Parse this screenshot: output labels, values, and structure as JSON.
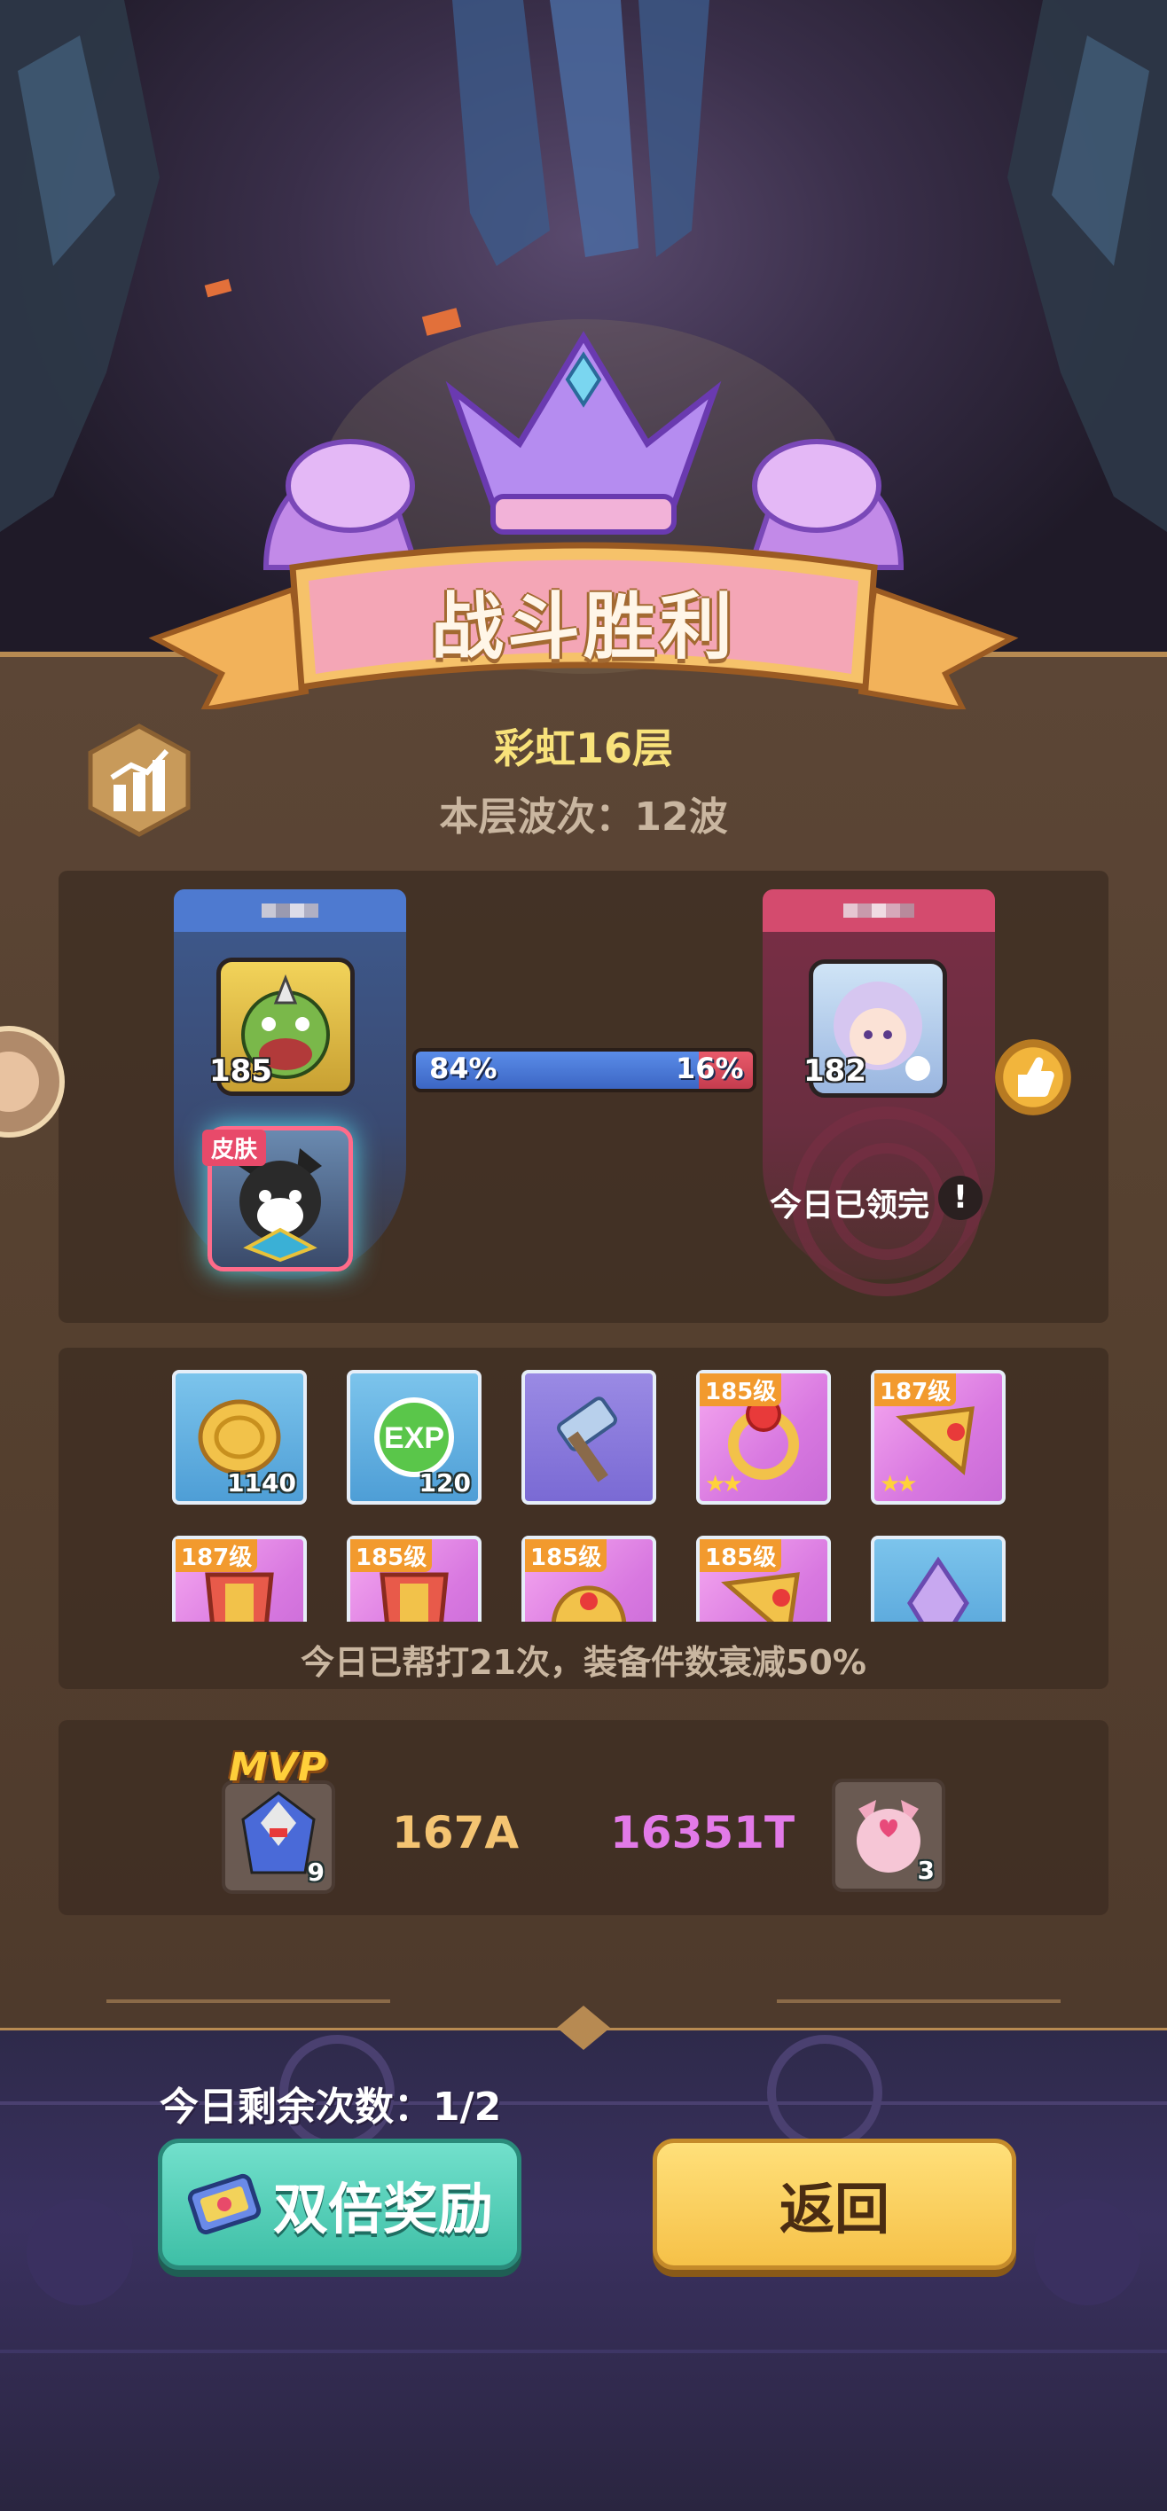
{
  "header": {
    "banner_title": "战斗胜利",
    "level_title": "彩虹16层",
    "wave_text": "本层波次：12波"
  },
  "battle": {
    "left_player": {
      "avatar_level": "185",
      "skin_badge": "皮肤"
    },
    "right_player": {
      "avatar_level": "182",
      "claimed_text": "今日已领完",
      "warning_glyph": "!"
    },
    "progress": {
      "left_percent_label": "84%",
      "right_percent_label": "16%",
      "left_fraction": 0.84
    }
  },
  "rewards": {
    "row1": [
      {
        "icon": "gold-coin-icon",
        "count": "1140",
        "style": "blue"
      },
      {
        "icon": "exp-orb-icon",
        "count": "120",
        "style": "blue"
      },
      {
        "icon": "hammer-icon",
        "count": "",
        "style": "purple"
      },
      {
        "icon": "ring-icon",
        "level": "185级",
        "stars": 2,
        "style": "pink"
      },
      {
        "icon": "horn-icon",
        "level": "187级",
        "stars": 2,
        "style": "pink"
      }
    ],
    "row2": [
      {
        "icon": "armor-icon",
        "level": "187级",
        "style": "pink"
      },
      {
        "icon": "armor-icon",
        "level": "185级",
        "style": "pink"
      },
      {
        "icon": "helmet-icon",
        "level": "185级",
        "style": "pink"
      },
      {
        "icon": "horn-icon",
        "level": "185级",
        "style": "pink"
      },
      {
        "icon": "crystal-icon",
        "level": "",
        "style": "blue"
      }
    ],
    "note": "今日已帮打21次，装备件数衰减50%"
  },
  "mvp": {
    "label": "MVP",
    "left_count": "9",
    "score_a": "167A",
    "score_t": "16351T",
    "right_count": "3"
  },
  "footer": {
    "remaining_text": "今日剩余次数：1/2",
    "double_reward_label": "双倍奖励",
    "back_label": "返回"
  },
  "colors": {
    "panel": "#55402f",
    "gold_text": "#f8e27a",
    "blue_team": "#4e7ad0",
    "red_team": "#d44b6e",
    "teal_button": "#3ebfa6",
    "yellow_button": "#f6c148"
  }
}
